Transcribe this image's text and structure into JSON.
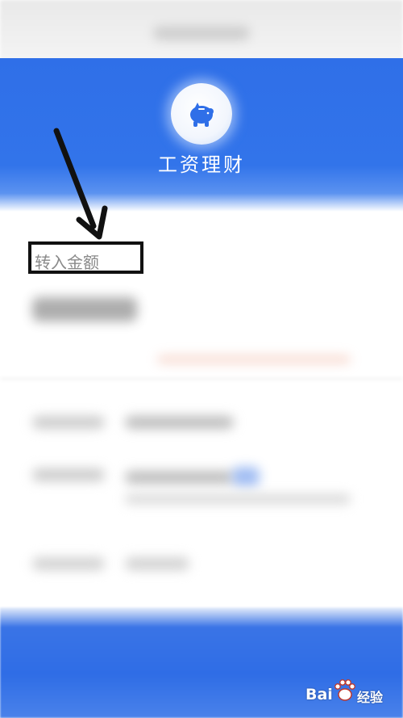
{
  "header": {
    "title": "工资理财",
    "logo_icon": "piggy-bank-icon",
    "background_color": "#3274ea"
  },
  "section": {
    "label": "转入金额"
  },
  "annotation": {
    "icon": "arrow-annotation",
    "color": "#111111"
  },
  "watermark": {
    "brand_left": "Bai",
    "brand_right": "经验",
    "icon": "paw-icon"
  }
}
